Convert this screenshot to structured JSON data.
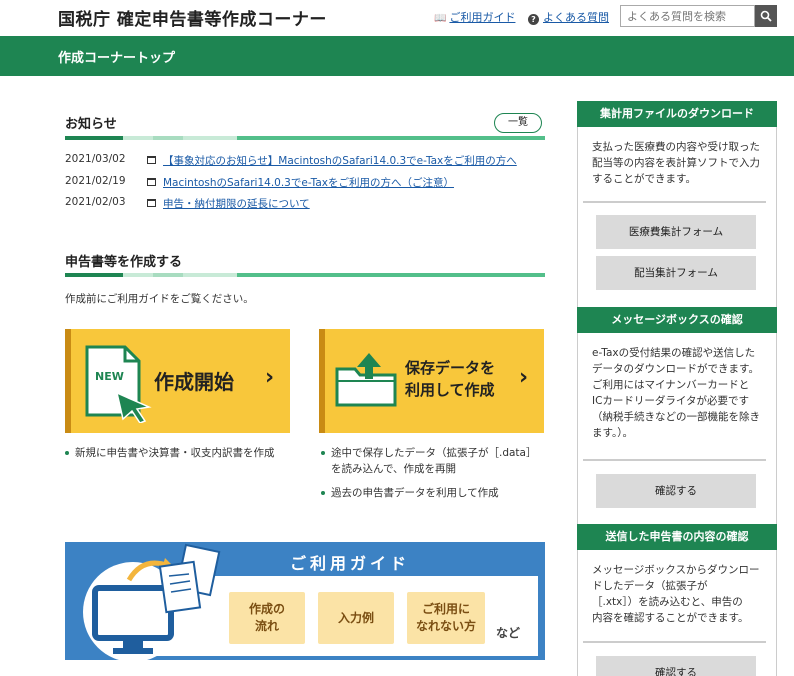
{
  "header": {
    "site_title": "国税庁 確定申告書等作成コーナー",
    "guide_link": "ご利用ガイド",
    "faq_link": "よくある質問",
    "search_placeholder": "よくある質問を検索"
  },
  "nav": {
    "breadcrumb": "作成コーナートップ"
  },
  "news": {
    "title": "お知らせ",
    "list_button": "一覧",
    "items": [
      {
        "date": "2021/03/02",
        "text": "【事象対応のお知らせ】MacintoshのSafari14.0.3でe-Taxをご利用の方へ"
      },
      {
        "date": "2021/02/19",
        "text": "MacintoshのSafari14.0.3でe-Taxをご利用の方へ（ご注意）"
      },
      {
        "date": "2021/02/03",
        "text": "申告・納付期限の延長について"
      }
    ]
  },
  "create": {
    "title": "申告書等を作成する",
    "note": "作成前にご利用ガイドをご覧ください。",
    "start_tile": {
      "badge": "NEW",
      "label": "作成開始"
    },
    "saved_tile": {
      "label_line1": "保存データを",
      "label_line2": "利用して作成"
    },
    "start_bullets": [
      "新規に申告書や決算書・収支内訳書を作成"
    ],
    "saved_bullets": [
      {
        "line1": "途中で保存したデータ（拡張子が［.data］",
        "line2": "を読み込んで、作成を再開"
      },
      {
        "line1": "過去の申告書データを利用して作成"
      }
    ]
  },
  "guide_banner": {
    "title": "ご利用ガイド",
    "box1_line1": "作成の",
    "box1_line2": "流れ",
    "box2": "入力例",
    "box3_line1": "ご利用に",
    "box3_line2": "なれない方",
    "suffix": "など"
  },
  "sidebar": {
    "download": {
      "header": "集計用ファイルのダウンロード",
      "lines": [
        "支払った医療費の内容や受け取った",
        "配当等の内容を表計算ソフトで入力",
        "することができます。"
      ],
      "button1": "医療費集計フォーム",
      "button2": "配当集計フォーム"
    },
    "messagebox": {
      "header": "メッセージボックスの確認",
      "lines": [
        "e-Taxの受付結果の確認や送信した",
        "データのダウンロードができます。",
        "ご利用にはマイナンバーカードと",
        "ICカードリーダライタが必要です",
        "（納税手続きなどの一部機能を除き",
        "ます。）。"
      ],
      "button": "確認する"
    },
    "sent": {
      "header": "送信した申告書の内容の確認",
      "lines": [
        "メッセージボックスからダウンロー",
        "ドしたデータ（拡張子が",
        "［.xtx］）を読み込むと、申告の",
        "内容を確認することができます。"
      ],
      "button": "確認する"
    }
  },
  "colors": {
    "brand_green": "#1e8552",
    "tile_yellow": "#f8c73b",
    "guide_blue": "#3c82c4"
  }
}
